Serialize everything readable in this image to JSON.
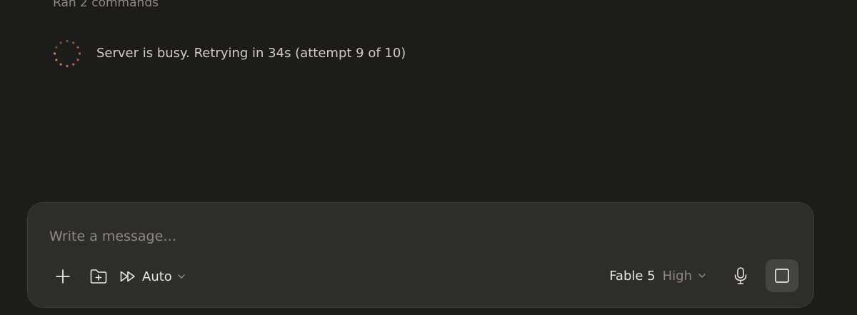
{
  "transcript": {
    "ran_commands": "Ran 2 commands",
    "status_message": "Server is busy. Retrying in 34s (attempt 9 of 10)"
  },
  "composer": {
    "placeholder": "Write a message…",
    "value": "",
    "mode_label": "Auto",
    "model_name": "Fable 5",
    "model_effort": "High"
  },
  "icons": {
    "spinner": "loading-spinner-icon",
    "add": "plus-icon",
    "folder": "folder-plus-icon",
    "mode": "fast-forward-icon",
    "chevron": "chevron-down-icon",
    "mic": "microphone-icon",
    "stop": "stop-square-icon"
  },
  "colors": {
    "background": "#1c1c1b",
    "composer_bg": "#2d2d2c",
    "spinner_accent": "#d9826b",
    "stop_button_bg": "#444442"
  }
}
